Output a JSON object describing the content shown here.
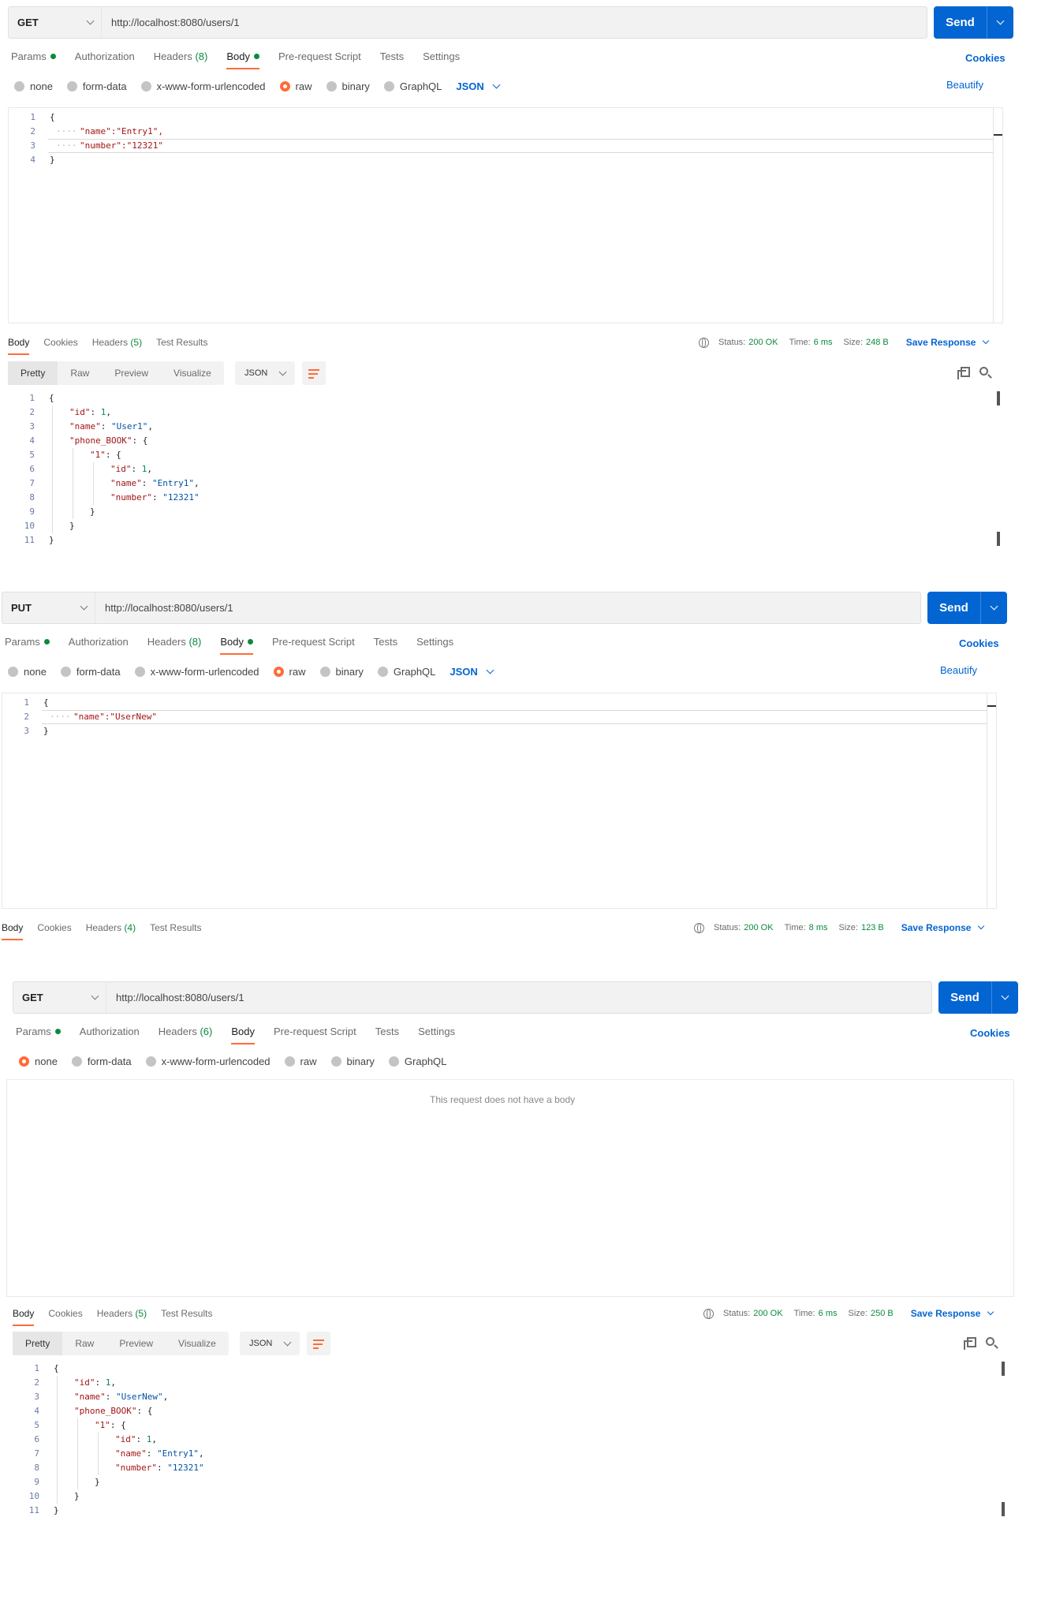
{
  "panel1": {
    "method": "GET",
    "url": "http://localhost:8080/users/1",
    "send": "Send",
    "tabs": {
      "params": "Params",
      "authorization": "Authorization",
      "headers": "Headers",
      "headers_count": "(8)",
      "body": "Body",
      "prerequest": "Pre-request Script",
      "tests": "Tests",
      "settings": "Settings"
    },
    "cookies": "Cookies",
    "beautify": "Beautify",
    "radios": {
      "none": "none",
      "form_data": "form-data",
      "urlencoded": "x-www-form-urlencoded",
      "raw": "raw",
      "binary": "binary",
      "graphql": "GraphQL",
      "json": "JSON"
    },
    "request_body": [
      "{",
      "\"name\":\"Entry1\",",
      "\"number\":\"12321\"",
      "}"
    ],
    "response": {
      "body": "Body",
      "cookies": "Cookies",
      "headers": "Headers",
      "headers_count": "(5)",
      "test_results": "Test Results",
      "status_label": "Status:",
      "status": "200 OK",
      "time_label": "Time:",
      "time": "6 ms",
      "size_label": "Size:",
      "size": "248 B",
      "save": "Save Response",
      "pretty": "Pretty",
      "raw": "Raw",
      "preview": "Preview",
      "visualize": "Visualize",
      "format": "JSON"
    }
  },
  "panel2": {
    "method": "PUT",
    "url": "http://localhost:8080/users/1",
    "send": "Send",
    "tabs": {
      "params": "Params",
      "authorization": "Authorization",
      "headers": "Headers",
      "headers_count": "(8)",
      "body": "Body",
      "prerequest": "Pre-request Script",
      "tests": "Tests",
      "settings": "Settings"
    },
    "cookies": "Cookies",
    "beautify": "Beautify",
    "radios": {
      "none": "none",
      "form_data": "form-data",
      "urlencoded": "x-www-form-urlencoded",
      "raw": "raw",
      "binary": "binary",
      "graphql": "GraphQL",
      "json": "JSON"
    },
    "request_body": [
      "{",
      "\"name\":\"UserNew\"",
      "}"
    ],
    "response": {
      "body": "Body",
      "cookies": "Cookies",
      "headers": "Headers",
      "headers_count": "(4)",
      "test_results": "Test Results",
      "status_label": "Status:",
      "status": "200 OK",
      "time_label": "Time:",
      "time": "8 ms",
      "size_label": "Size:",
      "size": "123 B",
      "save": "Save Response"
    }
  },
  "panel3": {
    "method": "GET",
    "url": "http://localhost:8080/users/1",
    "send": "Send",
    "tabs": {
      "params": "Params",
      "authorization": "Authorization",
      "headers": "Headers",
      "headers_count": "(6)",
      "body": "Body",
      "prerequest": "Pre-request Script",
      "tests": "Tests",
      "settings": "Settings"
    },
    "cookies": "Cookies",
    "radios": {
      "none": "none",
      "form_data": "form-data",
      "urlencoded": "x-www-form-urlencoded",
      "raw": "raw",
      "binary": "binary",
      "graphql": "GraphQL"
    },
    "no_body": "This request does not have a body",
    "response": {
      "body": "Body",
      "cookies": "Cookies",
      "headers": "Headers",
      "headers_count": "(5)",
      "test_results": "Test Results",
      "status_label": "Status:",
      "status": "200 OK",
      "time_label": "Time:",
      "time": "6 ms",
      "size_label": "Size:",
      "size": "250 B",
      "save": "Save Response",
      "pretty": "Pretty",
      "raw": "Raw",
      "preview": "Preview",
      "visualize": "Visualize",
      "format": "JSON"
    }
  },
  "response_json_1": [
    {
      "t": "{"
    },
    {
      "k": "\"id\"",
      "v": "1",
      "n": true,
      "c": ","
    },
    {
      "k": "\"name\"",
      "v": "\"User1\"",
      "c": ","
    },
    {
      "k": "\"phone_BOOK\"",
      "o": "{"
    },
    {
      "k": "\"1\"",
      "o": "{"
    },
    {
      "k": "\"id\"",
      "v": "1",
      "n": true,
      "c": ","
    },
    {
      "k": "\"name\"",
      "v": "\"Entry1\"",
      "c": ","
    },
    {
      "k": "\"number\"",
      "v": "\"12321\""
    },
    {
      "t": "}"
    },
    {
      "t": "}"
    },
    {
      "t": "}"
    }
  ],
  "response_json_3": [
    {
      "t": "{"
    },
    {
      "k": "\"id\"",
      "v": "1",
      "n": true,
      "c": ","
    },
    {
      "k": "\"name\"",
      "v": "\"UserNew\"",
      "c": ","
    },
    {
      "k": "\"phone_BOOK\"",
      "o": "{"
    },
    {
      "k": "\"1\"",
      "o": "{"
    },
    {
      "k": "\"id\"",
      "v": "1",
      "n": true,
      "c": ","
    },
    {
      "k": "\"name\"",
      "v": "\"Entry1\"",
      "c": ","
    },
    {
      "k": "\"number\"",
      "v": "\"12321\""
    },
    {
      "t": "}"
    },
    {
      "t": "}"
    },
    {
      "t": "}"
    }
  ],
  "colors": {
    "accent": "#ff6c37",
    "send": "#0265d2",
    "green": "#0b8a3e"
  },
  "icons": [
    "globe-icon",
    "copy-icon",
    "search-icon",
    "wrap-lines-icon",
    "chevron-down-icon"
  ]
}
